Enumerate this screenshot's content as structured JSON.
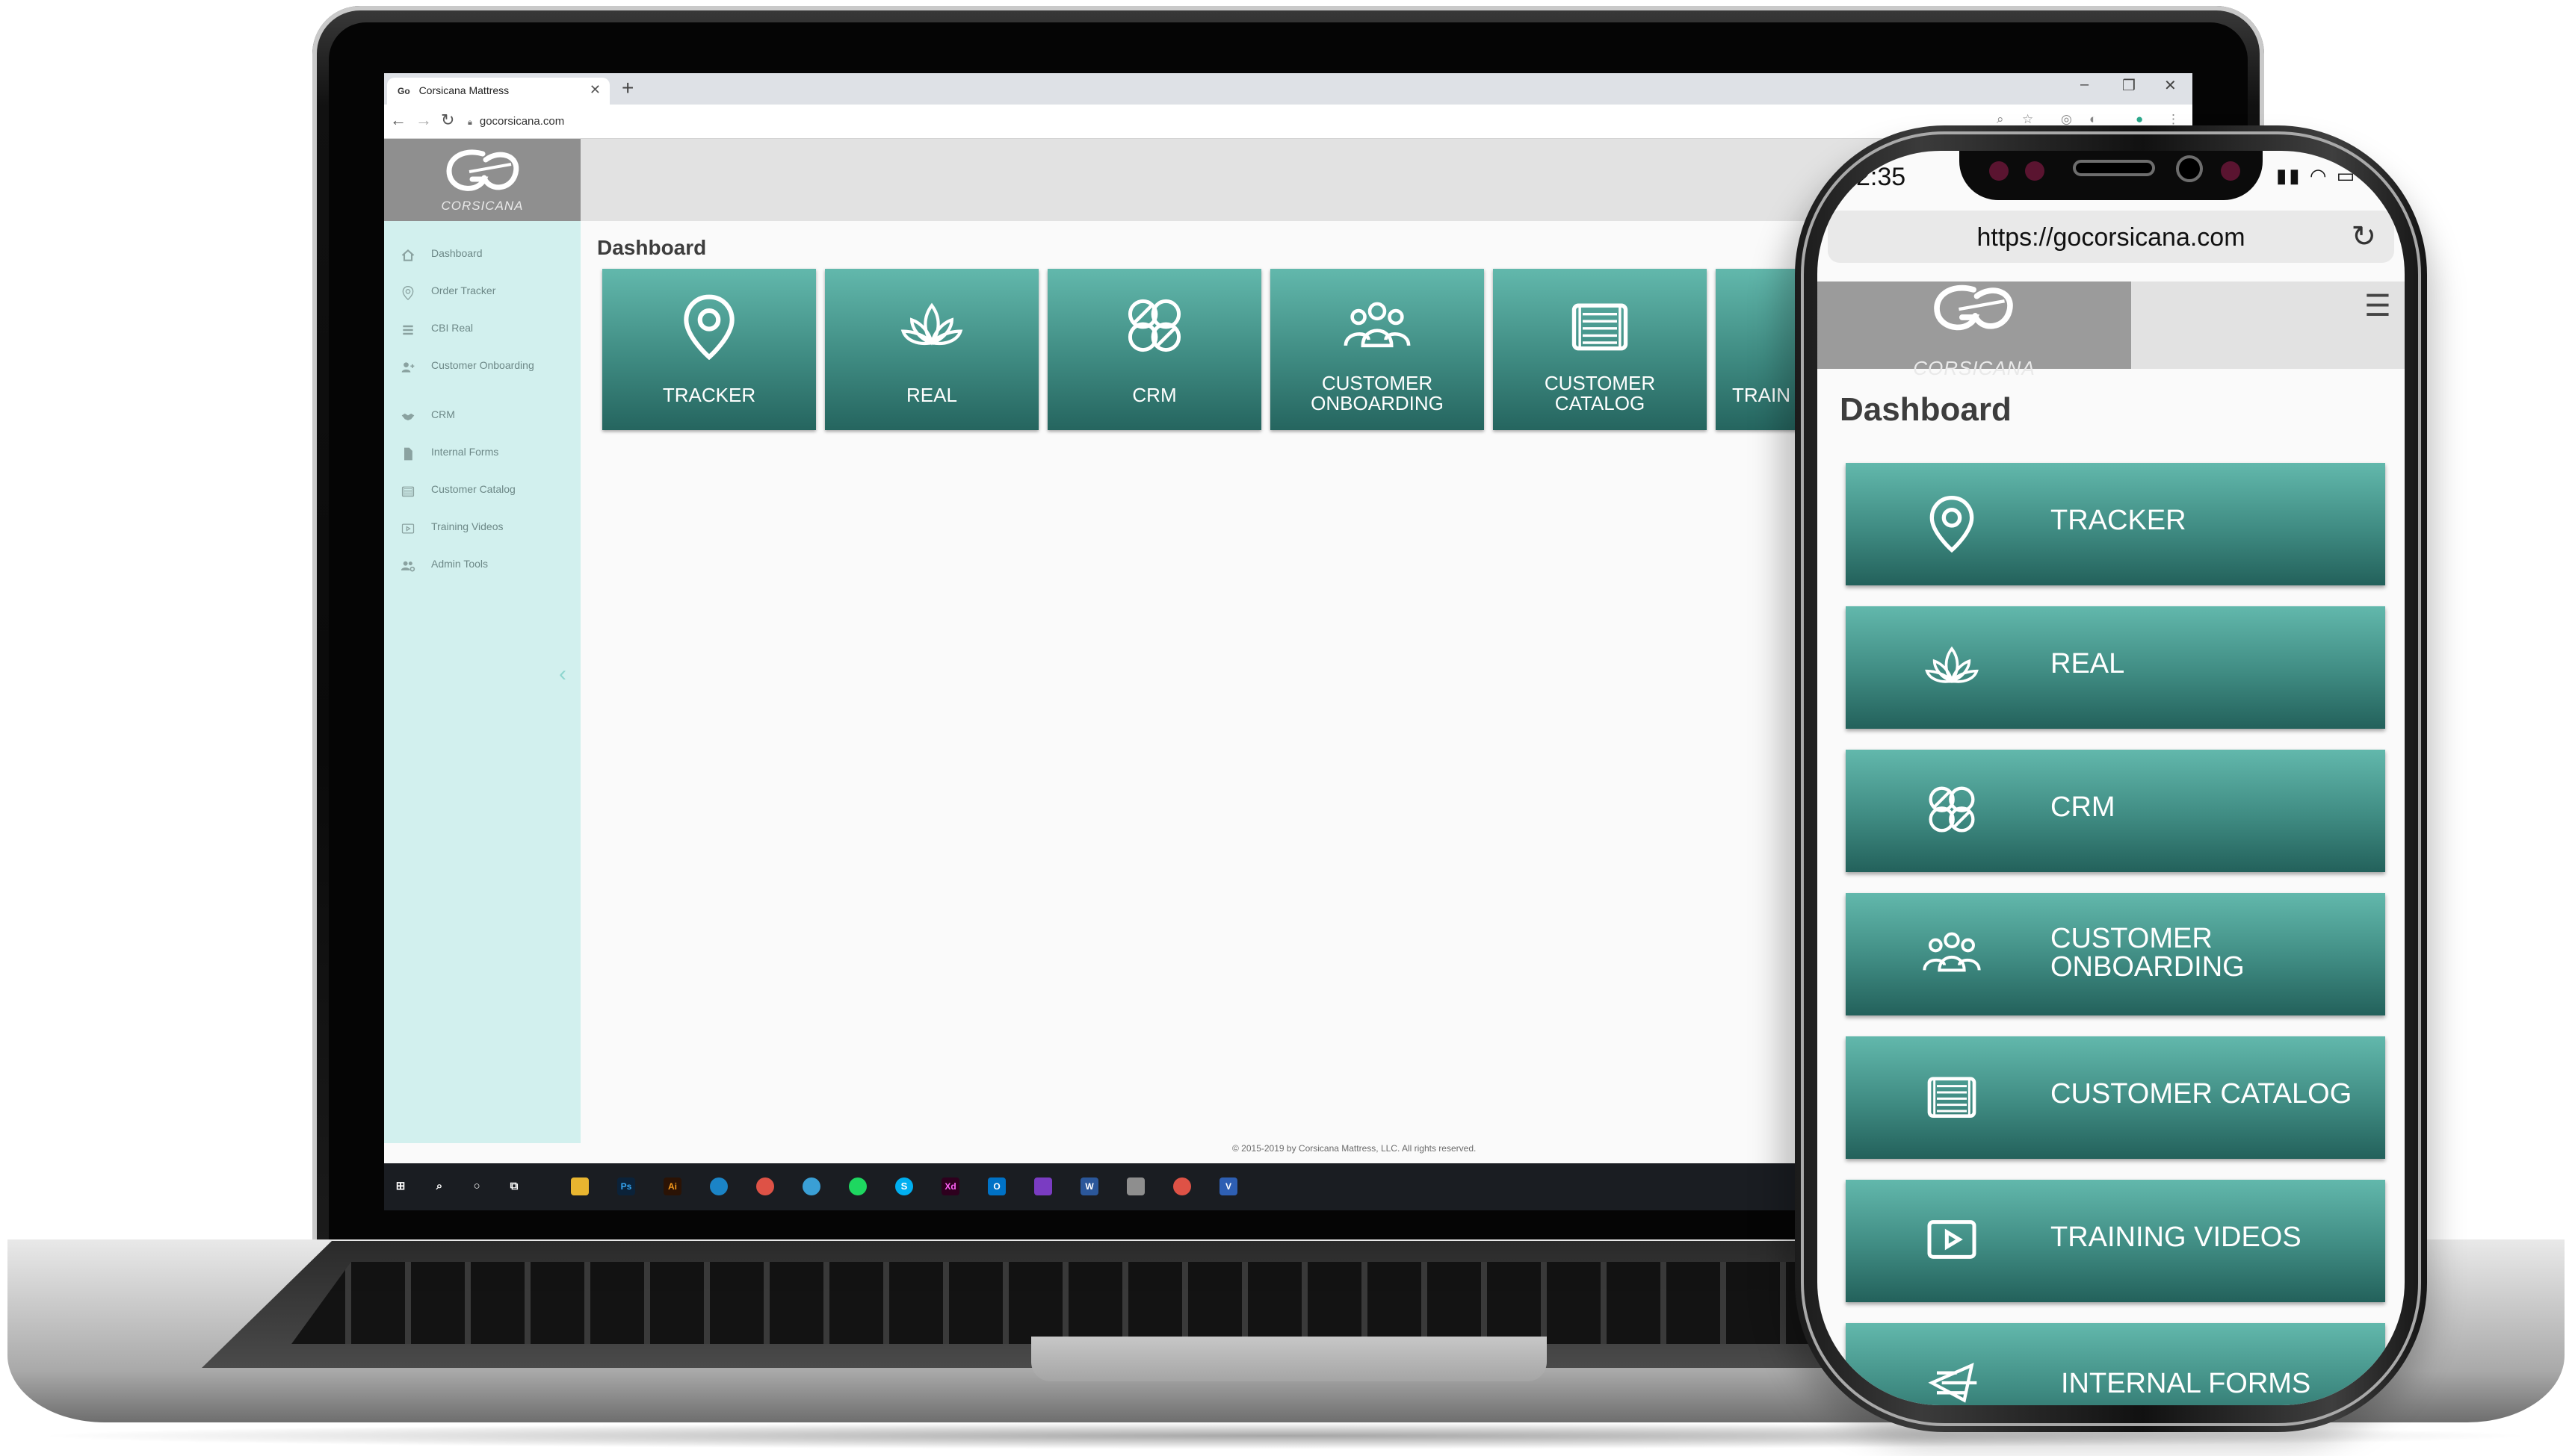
{
  "browser": {
    "tab_title": "Corsicana Mattress",
    "favicon": "Go",
    "url": "gocorsicana.com"
  },
  "logo": {
    "text": "CORSICANA"
  },
  "sidebar": {
    "items": [
      {
        "label": "Dashboard",
        "icon": "home-icon"
      },
      {
        "label": "Order Tracker",
        "icon": "map-pin-icon"
      },
      {
        "label": "CBI Real",
        "icon": "list-icon"
      },
      {
        "label": "Customer Onboarding",
        "icon": "user-plus-icon"
      },
      {
        "label": "CRM",
        "icon": "handshake-icon"
      },
      {
        "label": "Internal Forms",
        "icon": "file-icon"
      },
      {
        "label": "Customer Catalog",
        "icon": "catalog-icon"
      },
      {
        "label": "Training Videos",
        "icon": "video-icon"
      },
      {
        "label": "Admin Tools",
        "icon": "users-gear-icon"
      }
    ]
  },
  "dashboard": {
    "title": "Dashboard",
    "tiles": [
      {
        "label": "TRACKER",
        "icon": "map-pin-icon"
      },
      {
        "label": "REAL",
        "icon": "lotus-icon"
      },
      {
        "label": "CRM",
        "icon": "crm-circles-icon"
      },
      {
        "label": "CUSTOMER",
        "label2": "ONBOARDING",
        "icon": "group-icon"
      },
      {
        "label": "CUSTOMER",
        "label2": "CATALOG",
        "icon": "catalog-icon"
      },
      {
        "label": "TRAIN",
        "icon": "video-icon"
      }
    ]
  },
  "footer": {
    "text": "© 2015-2019 by Corsicana Mattress, LLC. All rights reserved."
  },
  "phone": {
    "time": "2:35",
    "url": "https://gocorsicana.com",
    "title": "Dashboard",
    "tiles": [
      {
        "label": "TRACKER",
        "icon": "map-pin-icon"
      },
      {
        "label": "REAL",
        "icon": "lotus-icon"
      },
      {
        "label": "CRM",
        "icon": "crm-circles-icon"
      },
      {
        "label": "CUSTOMER",
        "label2": "ONBOARDING",
        "icon": "group-icon"
      },
      {
        "label": "CUSTOMER CATALOG",
        "icon": "catalog-icon"
      },
      {
        "label": "TRAINING VIDEOS",
        "icon": "video-icon"
      },
      {
        "label": "INTERNAL FORMS",
        "icon": "forms-icon"
      }
    ]
  },
  "colors": {
    "tile_top": "#62b8ac",
    "tile_bottom": "#25655f",
    "sidebar_bg": "#d2f0ee",
    "logo_bg": "#8f8f8f"
  }
}
